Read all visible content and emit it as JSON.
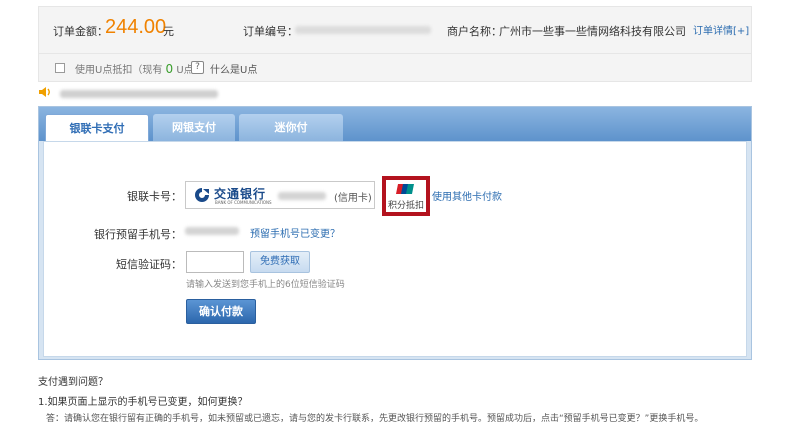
{
  "order": {
    "amount_label": "订单金额：",
    "amount_value": "244.00",
    "amount_unit": "元",
    "order_no_label": "订单编号：",
    "merchant_label": "商户名称：",
    "merchant_name": "广州市一些事一些情网络科技有限公司",
    "detail_link": "订单详情[+]"
  },
  "upoint": {
    "checkbox_text_prefix": "使用U点抵扣（现有",
    "points": "0",
    "checkbox_text_suffix": "U点）",
    "help_icon": "?",
    "what_is": "什么是U点"
  },
  "tabs": [
    {
      "label": "银联卡支付",
      "active": true
    },
    {
      "label": "网银支付",
      "active": false
    },
    {
      "label": "迷你付",
      "active": false
    }
  ],
  "form": {
    "card_label": "银联卡号：",
    "bank_name": "交通银行",
    "bank_name_en": "BANK OF COMMUNICATIONS",
    "card_type": "(信用卡)",
    "points_icon_name": "unionpay-icon",
    "points_label": "积分抵扣",
    "other_card_link": "使用其他卡付款",
    "phone_label": "银行预留手机号：",
    "phone_changed_link": "预留手机号已变更？",
    "sms_label": "短信验证码：",
    "sms_value": "",
    "free_get_button": "免费获取",
    "sms_hint": "请输入发送到您手机上的6位短信验证码",
    "confirm_button": "确认付款"
  },
  "help": {
    "title": "支付遇到问题？",
    "question_1": "1.如果页面上显示的手机号已变更，如何更换？",
    "answer_1": "答：请确认您在银行留有正确的手机号，如未预留或已遗忘，请与您的发卡行联系，先更改银行预留的手机号。预留成功后，点击“预留手机号已变更？”更换手机号。"
  },
  "colors": {
    "amount": "#f08200",
    "link": "#2b6cb0",
    "highlight_border": "#b3121e",
    "tab_bar": "#5e93cc"
  }
}
